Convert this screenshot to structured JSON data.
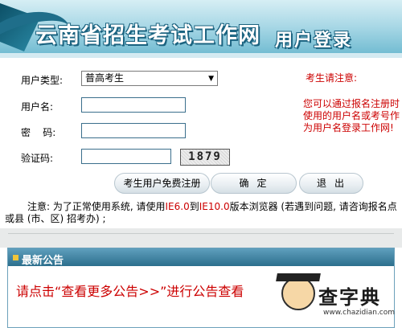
{
  "banner": {
    "site_title": "云南省招生考试工作网",
    "sub_title": "用户登录"
  },
  "form": {
    "type_label": "用户类型:",
    "type_value": "普高考生",
    "user_label": "用户名:",
    "pass_label": "密    码:",
    "code_label": "验证码:",
    "captcha": "1879"
  },
  "notice": {
    "head": "考生请注意:",
    "body": "您可以通过报名注册时使用的用户名或考号作为用户名登录工作网!"
  },
  "buttons": {
    "register": "考生用户免费注册",
    "ok": "确定",
    "exit": "退出"
  },
  "tip": {
    "prefix": "注意: 为了正常使用系统, 请使用",
    "ie6": "IE6.0",
    "mid": "到",
    "ie10": "IE10.0",
    "suffix": "版本浏览器 (若遇到问题, 请咨询报名点或县 (市、区) 招考办) ;"
  },
  "news": {
    "title": "最新公告",
    "link": "请点击“查看更多公告>>”进行公告查看"
  },
  "watermark": {
    "text": "查字典",
    "url": "www.chazidian.com"
  },
  "colors": {
    "accent": "#1b6380",
    "warning_red": "#cc0000",
    "panel_head": "#2c6f8d"
  }
}
